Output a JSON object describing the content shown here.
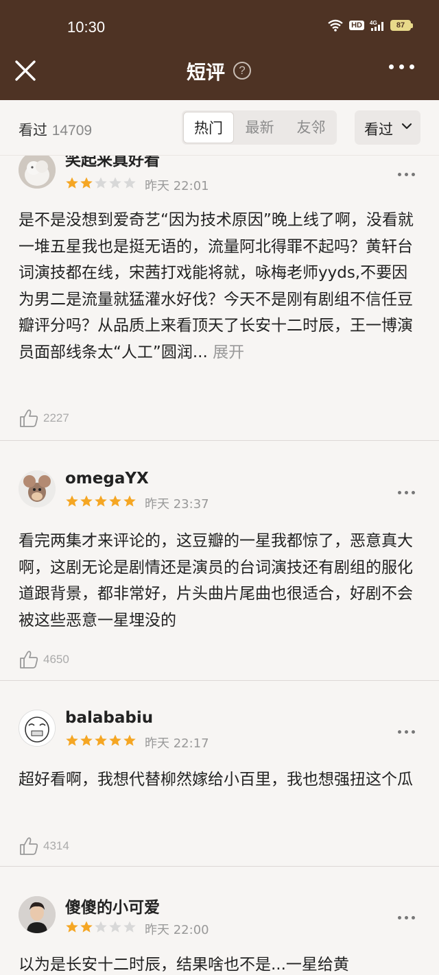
{
  "status": {
    "time": "10:30",
    "hd": "HD",
    "network": "4G",
    "battery": "87"
  },
  "header": {
    "title": "短评",
    "help_icon": "?"
  },
  "filter": {
    "count_label": "看过",
    "count": "14709",
    "tabs": [
      {
        "label": "热门",
        "active": true
      },
      {
        "label": "最新",
        "active": false
      },
      {
        "label": "友邻",
        "active": false
      }
    ],
    "dropdown": "看过"
  },
  "reviews": [
    {
      "username": "笑起来真好看",
      "rating": 2,
      "time": "昨天 22:01",
      "text": "是不是没想到爱奇艺“因为技术原因”晚上线了啊，没看就一堆五星我也是挺无语的，流量阿北得罪不起吗？黄轩台词演技都在线，宋茜打戏能将就，咏梅老师yyds,不要因为男二是流量就猛灌水好伐？今天不是刚有剧组不信任豆瓣评分吗？从品质上来看顶天了长安十二时辰，王一博演员面部线条太“人工”圆润...",
      "expand": "展开",
      "likes": "2227"
    },
    {
      "username": "omegaYX",
      "rating": 5,
      "time": "昨天 23:37",
      "text": "看完两集才来评论的，这豆瓣的一星我都惊了，恶意真大啊，这剧无论是剧情还是演员的台词演技还有剧组的服化道跟背景，都非常好，片头曲片尾曲也很适合，好剧不会被这些恶意一星埋没的",
      "likes": "4650"
    },
    {
      "username": "balababiu",
      "rating": 5,
      "time": "昨天 22:17",
      "text": "超好看啊，我想代替柳然嫁给小百里，我也想强扭这个瓜",
      "likes": "4314"
    },
    {
      "username": "傻傻的小可爱",
      "rating": 2,
      "time": "昨天 22:00",
      "text": "以为是长安十二时辰，结果啥也不是...一星给黄"
    }
  ],
  "colors": {
    "header_bg": "#4e3324",
    "star_on": "#f5a623",
    "star_off": "#d8d8d8"
  }
}
